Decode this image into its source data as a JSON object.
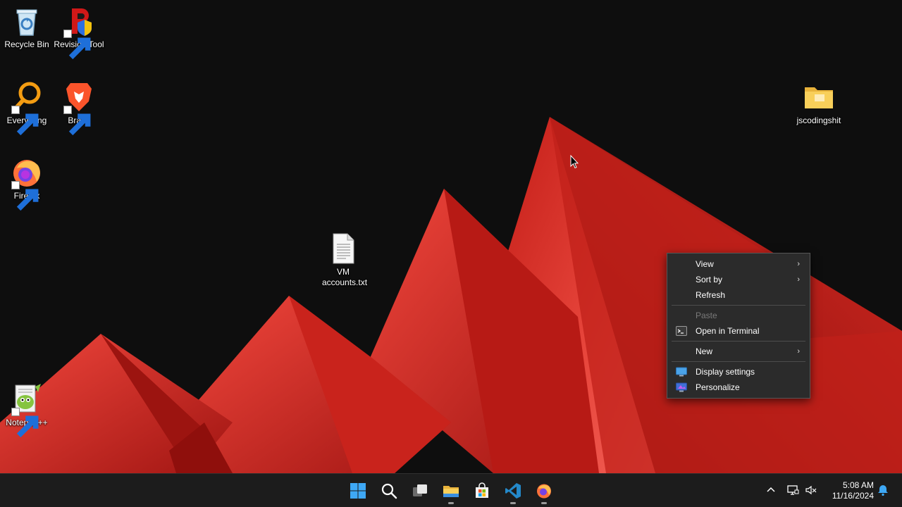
{
  "desktop": {
    "icons": [
      {
        "label": "Recycle Bin",
        "icon": "recycle-bin-icon"
      },
      {
        "label": "Revision Tool",
        "icon": "revision-tool-icon"
      },
      {
        "label": "Everything",
        "icon": "everything-search-icon"
      },
      {
        "label": "Brave",
        "icon": "brave-icon"
      },
      {
        "label": "Firefox",
        "icon": "firefox-icon"
      },
      {
        "label": "VM accounts.txt",
        "icon": "text-file-icon"
      },
      {
        "label": "jscodingshit",
        "icon": "folder-icon"
      },
      {
        "label": "Notepad++",
        "icon": "notepad-plus-plus-icon"
      }
    ]
  },
  "context_menu": {
    "view": "View",
    "sort_by": "Sort by",
    "refresh": "Refresh",
    "paste": "Paste",
    "open_terminal": "Open in Terminal",
    "new": "New",
    "display_settings": "Display settings",
    "personalize": "Personalize",
    "submenu_glyph": "›"
  },
  "taskbar": {
    "apps": [
      "start-icon",
      "search-icon",
      "task-view-icon",
      "file-explorer-icon",
      "microsoft-store-icon",
      "vscode-icon",
      "firefox-icon"
    ],
    "tray": [
      "chevron-up-icon",
      "network-icon",
      "volume-muted-icon",
      "notification-bell-icon"
    ]
  },
  "clock": {
    "time": "5:08 AM",
    "date": "11/16/2024"
  },
  "colors": {
    "wallpaper_red": "#e2332b",
    "menu_bg": "#2b2b2b",
    "taskbar_bg": "#1c1c1c"
  }
}
